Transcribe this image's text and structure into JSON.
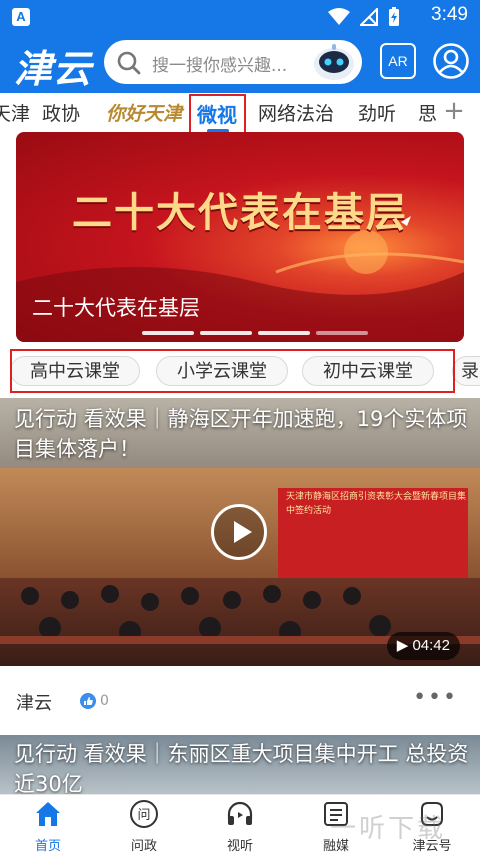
{
  "status_bar": {
    "time": "3:49",
    "app_badge": "A"
  },
  "header": {
    "logo": "津云",
    "search_placeholder": "搜一搜你感兴趣...",
    "ar_label": "AR"
  },
  "tabs": [
    {
      "label": "天津"
    },
    {
      "label": "政协"
    },
    {
      "label": "你好天津"
    },
    {
      "label": "微视",
      "active": true
    },
    {
      "label": "网络法治"
    },
    {
      "label": "劲听"
    },
    {
      "label": "思"
    }
  ],
  "tab_add": "+",
  "banner": {
    "headline": "二十大代表在基层",
    "caption": "二十大代表在基层"
  },
  "course_chips": [
    "高中云课堂",
    "小学云课堂",
    "初中云课堂",
    "录"
  ],
  "video1": {
    "title": "见行动 看效果｜静海区开年加速跑，19个实体项目集体落户！",
    "screen_text": "天津市静海区招商引资表彰大会暨新春项目集中签约活动",
    "duration": "04:42",
    "source": "津云",
    "likes": "0"
  },
  "video2": {
    "title": "见行动 看效果｜东丽区重大项目集中开工 总投资近30亿"
  },
  "bottom_nav": [
    {
      "label": "首页",
      "icon": "home-icon",
      "active": true
    },
    {
      "label": "问政",
      "icon": "question-icon"
    },
    {
      "label": "视听",
      "icon": "headphones-icon"
    },
    {
      "label": "融媒",
      "icon": "media-icon"
    },
    {
      "label": "津云号",
      "icon": "account-icon"
    }
  ],
  "watermark": "一听下载",
  "colors": {
    "brand": "#1677e6",
    "highlight": "#e02020"
  }
}
